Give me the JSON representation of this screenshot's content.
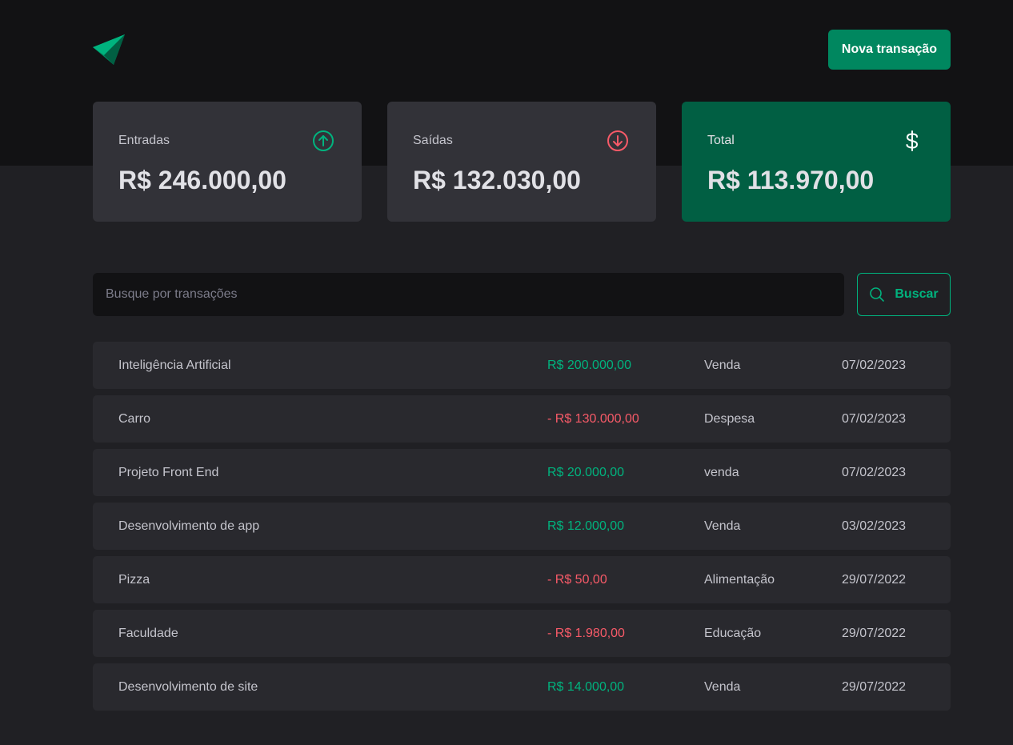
{
  "header": {
    "logo_icon": "arrows-logo-icon",
    "new_transaction_label": "Nova transação"
  },
  "summary": [
    {
      "label": "Entradas",
      "value": "R$ 246.000,00",
      "icon": "arrow-circle-up-icon",
      "icon_color": "#00B37E"
    },
    {
      "label": "Saídas",
      "value": "R$ 132.030,00",
      "icon": "arrow-circle-down-icon",
      "icon_color": "#F75A68"
    },
    {
      "label": "Total",
      "value": "R$ 113.970,00",
      "icon": "currency-dollar-icon",
      "icon_color": "#FFFFFF"
    }
  ],
  "search": {
    "placeholder": "Busque por transações",
    "value": "",
    "button_label": "Buscar",
    "button_icon": "magnifying-glass-icon"
  },
  "transactions": [
    {
      "description": "Inteligência Artificial",
      "amount": "R$ 200.000,00",
      "type": "income",
      "category": "Venda",
      "date": "07/02/2023"
    },
    {
      "description": "Carro",
      "amount": "- R$ 130.000,00",
      "type": "outcome",
      "category": "Despesa",
      "date": "07/02/2023"
    },
    {
      "description": "Projeto Front End",
      "amount": "R$ 20.000,00",
      "type": "income",
      "category": "venda",
      "date": "07/02/2023"
    },
    {
      "description": "Desenvolvimento de app",
      "amount": "R$ 12.000,00",
      "type": "income",
      "category": "Venda",
      "date": "03/02/2023"
    },
    {
      "description": "Pizza",
      "amount": "- R$ 50,00",
      "type": "outcome",
      "category": "Alimentação",
      "date": "29/07/2022"
    },
    {
      "description": "Faculdade",
      "amount": "- R$ 1.980,00",
      "type": "outcome",
      "category": "Educação",
      "date": "29/07/2022"
    },
    {
      "description": "Desenvolvimento de site",
      "amount": "R$ 14.000,00",
      "type": "income",
      "category": "Venda",
      "date": "29/07/2022"
    }
  ],
  "colors": {
    "brand": "#00875F",
    "brand_light": "#00B37E",
    "danger": "#F75A68",
    "background": "#202024",
    "header_background": "#121214",
    "card": "#323238",
    "total_card": "#015F43",
    "row": "#29292E"
  }
}
